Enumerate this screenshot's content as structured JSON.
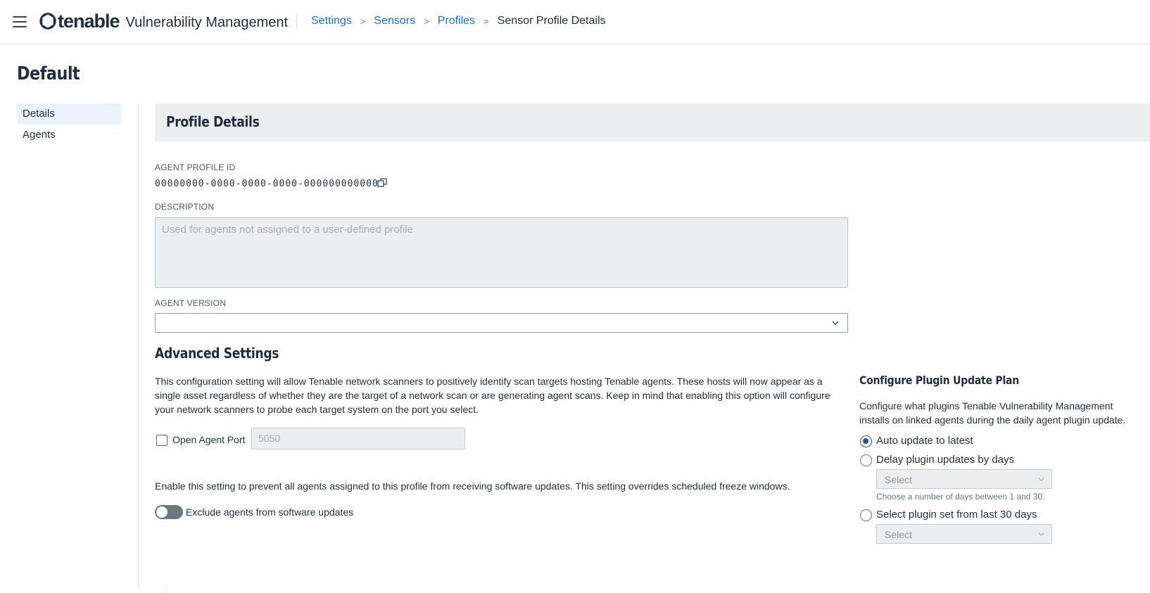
{
  "header": {
    "brand": "tenable",
    "product": "Vulnerability Management",
    "breadcrumb": [
      "Settings",
      "Sensors",
      "Profiles"
    ],
    "current": "Sensor Profile Details",
    "separator": ">"
  },
  "page": {
    "title": "Default"
  },
  "sidenav": {
    "items": [
      {
        "label": "Details"
      },
      {
        "label": "Agents"
      }
    ]
  },
  "profile_details": {
    "heading": "Profile Details",
    "agent_profile_id_label": "AGENT PROFILE ID",
    "agent_profile_id": "00000000-0000-0000-0000-000000000000",
    "description_label": "DESCRIPTION",
    "description_placeholder": "Used for agents not assigned to a user-defined profile",
    "agent_version_label": "AGENT VERSION",
    "agent_version_value": ""
  },
  "advanced": {
    "title": "Advanced Settings",
    "description": "This configuration setting will allow Tenable network scanners to positively identify scan targets hosting Tenable agents. These hosts will now appear as a single asset regardless of whether they are the target of a network scan or are generating agent scans.  Keep in mind that enabling this option will configure your network scanners to probe each target system on the port you select.",
    "open_port_label": "Open Agent Port",
    "open_port_checked": false,
    "port_placeholder": "5050",
    "exclude_description": "Enable this setting to prevent all agents assigned to this profile from receiving software updates. This setting overrides scheduled freeze windows.",
    "exclude_label": "Exclude agents from software updates",
    "exclude_enabled": false
  },
  "plugin_plan": {
    "title": "Configure Plugin Update Plan",
    "description": "Configure what plugins Tenable Vulnerability Management installs on linked agents during the daily agent plugin update.",
    "options": [
      {
        "label": "Auto update to latest",
        "selected": true
      },
      {
        "label": "Delay plugin updates by days",
        "selected": false
      },
      {
        "label": "Select plugin set from last 30 days",
        "selected": false
      }
    ],
    "delay_select": "Select",
    "delay_hint": "Choose a number of days between 1 and 30.",
    "set_select": "Select"
  },
  "colors": {
    "link": "#1a73c8",
    "radio_selected": "#2b4f7c",
    "panel_bg": "#eceef0"
  }
}
